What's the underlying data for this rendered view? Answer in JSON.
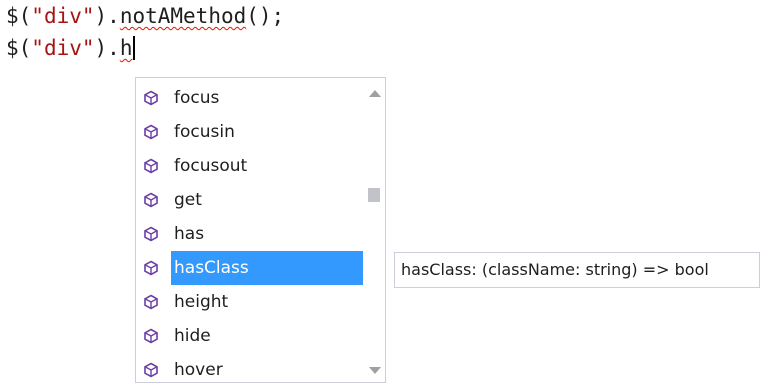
{
  "editor": {
    "line1": {
      "prefix": "$(",
      "string": "\"div\"",
      "middle": ").",
      "error_member": "notAMethod",
      "suffix": "();"
    },
    "line2": {
      "prefix": "$(",
      "string": "\"div\"",
      "middle": ").",
      "typed": "h"
    }
  },
  "completion": {
    "icon": "method-cube-icon",
    "items": [
      {
        "label": "focus"
      },
      {
        "label": "focusin"
      },
      {
        "label": "focusout"
      },
      {
        "label": "get"
      },
      {
        "label": "has"
      },
      {
        "label": "hasClass",
        "selected": true
      },
      {
        "label": "height"
      },
      {
        "label": "hide"
      },
      {
        "label": "hover"
      }
    ]
  },
  "tooltip": {
    "text": "hasClass: (className: string) => bool"
  },
  "colors": {
    "selection": "#3399ff",
    "string": "#a31515",
    "error_squiggle": "#e51400",
    "method_icon": "#6c3fa6"
  }
}
